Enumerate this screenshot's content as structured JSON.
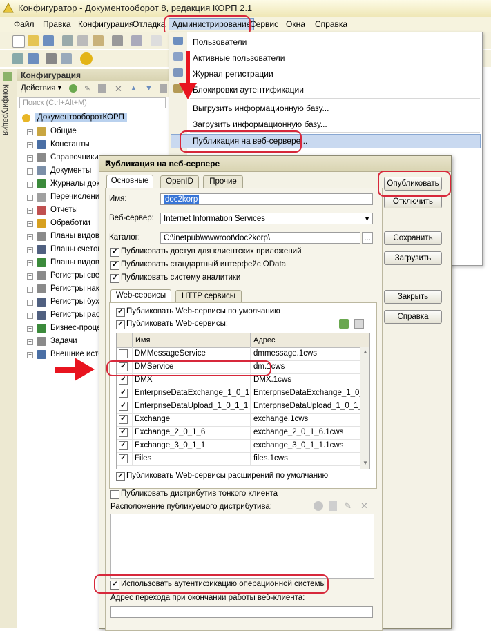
{
  "window": {
    "title": "Конфигуратор - Документооборот 8, редакция КОРП 2.1"
  },
  "menubar": [
    "Файл",
    "Правка",
    "Конфигурация",
    "Отладка",
    "Администрирование",
    "Сервис",
    "Окна",
    "Справка"
  ],
  "side_tab": "Конфигурация",
  "config_panel": {
    "title": "Конфигурация",
    "actions_label": "Действия",
    "search_placeholder": "Поиск (Ctrl+Alt+M)",
    "root": "ДокументооборотКОРП",
    "items": [
      {
        "label": "Общие",
        "icon": "folder-icon",
        "color": "#c9a641"
      },
      {
        "label": "Константы",
        "icon": "constants-icon",
        "color": "#4a6fa5"
      },
      {
        "label": "Справочники",
        "icon": "catalog-icon",
        "color": "#8a8a8a"
      },
      {
        "label": "Документы",
        "icon": "document-icon",
        "color": "#7b8fa8"
      },
      {
        "label": "Журналы док",
        "icon": "journal-icon",
        "color": "#3b8a3b"
      },
      {
        "label": "Перечислени",
        "icon": "enum-icon",
        "color": "#a0a0a0"
      },
      {
        "label": "Отчеты",
        "icon": "report-icon",
        "color": "#c05050"
      },
      {
        "label": "Обработки",
        "icon": "processing-icon",
        "color": "#d7a020"
      },
      {
        "label": "Планы видов",
        "icon": "chart-plan-icon",
        "color": "#8a8a8a"
      },
      {
        "label": "Планы счетов",
        "icon": "accounts-icon",
        "color": "#506080"
      },
      {
        "label": "Планы видов",
        "icon": "calc-plan-icon",
        "color": "#3b8a3b"
      },
      {
        "label": "Регистры све",
        "icon": "info-register-icon",
        "color": "#8a8a8a"
      },
      {
        "label": "Регистры нак",
        "icon": "accum-register-icon",
        "color": "#8a8a8a"
      },
      {
        "label": "Регистры бух",
        "icon": "acc-register-icon",
        "color": "#506080"
      },
      {
        "label": "Регистры рас",
        "icon": "calc-register-icon",
        "color": "#506080"
      },
      {
        "label": "Бизнес-проце",
        "icon": "business-process-icon",
        "color": "#3b8a3b"
      },
      {
        "label": "Задачи",
        "icon": "tasks-icon",
        "color": "#8a8a8a"
      },
      {
        "label": "Внешние исто",
        "icon": "external-source-icon",
        "color": "#4a6fa5"
      }
    ]
  },
  "admin_menu": {
    "items": [
      "Пользователи",
      "Активные пользователи",
      "Журнал регистрации",
      "Блокировки аутентификации",
      "Выгрузить информационную базу...",
      "Загрузить информационную базу...",
      "Публикация на веб-сервере..."
    ]
  },
  "dialog": {
    "title": "Публикация на веб-сервере",
    "tabs": [
      "Основные",
      "OpenID",
      "Прочие"
    ],
    "name_label": "Имя:",
    "name_value": "doc2korp",
    "webserver_label": "Веб-сервер:",
    "webserver_value": "Internet Information Services",
    "catalog_label": "Каталог:",
    "catalog_value": "C:\\inetpub\\wwwroot\\doc2korp\\",
    "browse_label": "...",
    "checks_top": [
      "Публиковать доступ для клиентских приложений",
      "Публиковать стандартный интерфейс OData",
      "Публиковать систему аналитики"
    ],
    "inner_tabs": [
      "Web-сервисы",
      "HTTP сервисы"
    ],
    "ws_default_label": "Публиковать Web-сервисы по умолчанию",
    "ws_publish_label": "Публиковать Web-сервисы:",
    "table_headers": [
      "Имя",
      "Адрес"
    ],
    "table_rows": [
      {
        "name": "DMMessageService",
        "addr": "dmmessage.1cws",
        "checked": false
      },
      {
        "name": "DMService",
        "addr": "dm.1cws",
        "checked": true
      },
      {
        "name": "DMX",
        "addr": "DMX.1cws",
        "checked": true
      },
      {
        "name": "EnterpriseDataExchange_1_0_1...",
        "addr": "EnterpriseDataExchange_1_0_...",
        "checked": true
      },
      {
        "name": "EnterpriseDataUpload_1_0_1_1",
        "addr": "EnterpriseDataUpload_1_0_1_...",
        "checked": true
      },
      {
        "name": "Exchange",
        "addr": "exchange.1cws",
        "checked": true
      },
      {
        "name": "Exchange_2_0_1_6",
        "addr": "exchange_2_0_1_6.1cws",
        "checked": true
      },
      {
        "name": "Exchange_3_0_1_1",
        "addr": "exchange_3_0_1_1.1cws",
        "checked": true
      },
      {
        "name": "Files",
        "addr": "files.1cws",
        "checked": true
      }
    ],
    "ws_ext_label": "Публиковать Web-сервисы расширений по умолчанию",
    "thin_client_label": "Публиковать дистрибутив тонкого клиента",
    "distrib_location_label": "Расположение публикуемого дистрибутива:",
    "os_auth_label": "Использовать аутентификацию операционной системы",
    "exit_url_label": "Адрес перехода при окончании работы веб-клиента:",
    "buttons": {
      "publish": "Опубликовать",
      "disable": "Отключить",
      "save": "Сохранить",
      "load": "Загрузить",
      "close": "Закрыть",
      "help": "Справка"
    }
  },
  "accent": {
    "highlight": "#d7283b",
    "selection": "#b9d1ee"
  }
}
